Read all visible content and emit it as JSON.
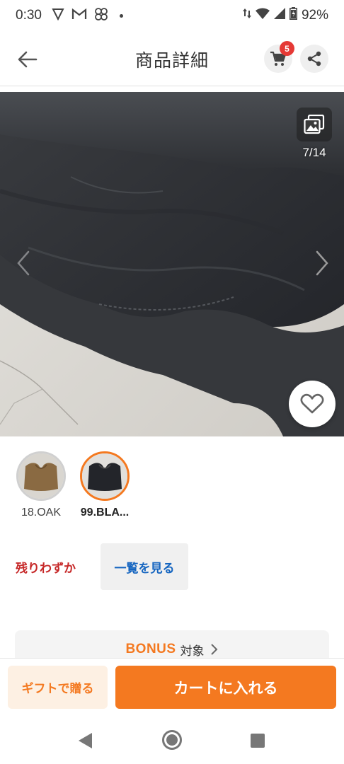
{
  "status_bar": {
    "time": "0:30",
    "battery": "92%"
  },
  "header": {
    "title": "商品詳細",
    "cart_count": "5"
  },
  "gallery": {
    "counter": "7/14"
  },
  "variants": [
    {
      "label": "18.OAK",
      "selected": false
    },
    {
      "label": "99.BLA...",
      "selected": true
    }
  ],
  "stock": {
    "status": "残りわずか",
    "list_button": "一覧を見る"
  },
  "bonus": {
    "logo": "BONUS",
    "text": "対象"
  },
  "actions": {
    "gift_button": "ギフトで贈る",
    "add_to_cart_button": "カートに入れる"
  },
  "colors": {
    "accent": "#f47920",
    "badge": "#e53935",
    "link": "#1565c0",
    "stock_warning": "#c62828"
  }
}
